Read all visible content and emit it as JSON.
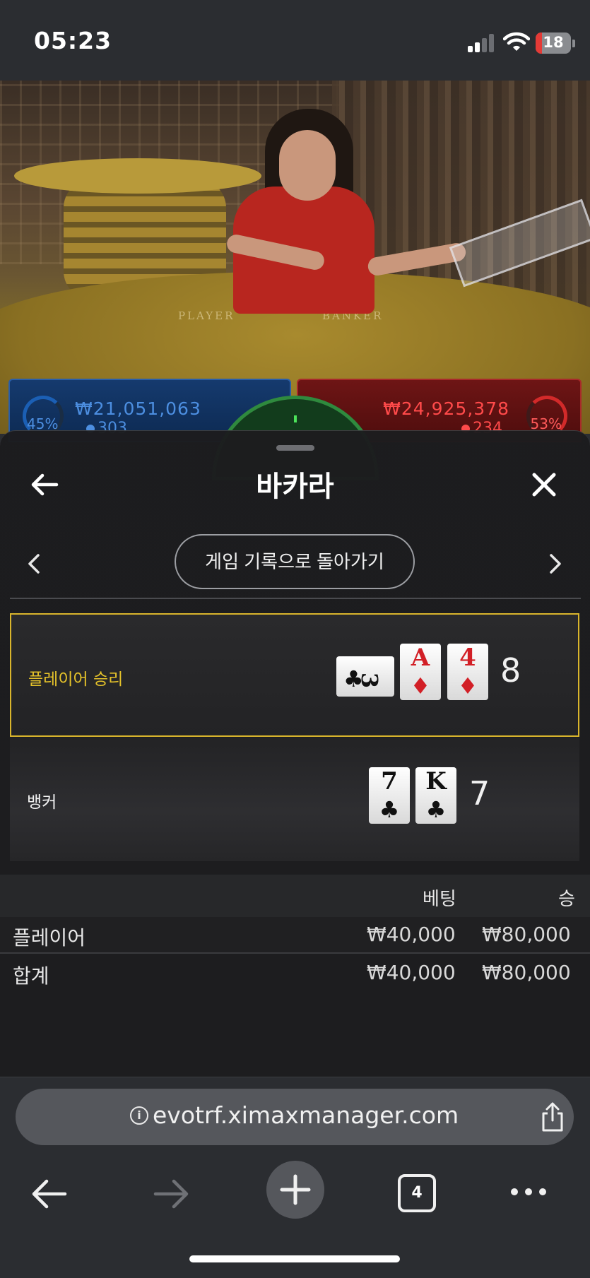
{
  "status_bar": {
    "time": "05:23",
    "battery": "18",
    "battery_color": "#e43a36"
  },
  "video": {
    "felt_player": "PLAYER",
    "felt_banker": "BANKER",
    "player_bets": {
      "percent": "45%",
      "amount": "₩21,051,063",
      "count": "303"
    },
    "banker_bets": {
      "percent": "53%",
      "amount": "₩24,925,378",
      "count": "234"
    }
  },
  "sheet": {
    "title": "바카라",
    "history_button": "게임 기록으로 돌아가기",
    "results": {
      "player": {
        "label": "플레이어 승리",
        "score": "8",
        "cards": [
          {
            "rank": "3",
            "suit": "♣",
            "color": "black",
            "sideways": true
          },
          {
            "rank": "A",
            "suit": "♦",
            "color": "red"
          },
          {
            "rank": "4",
            "suit": "♦",
            "color": "red"
          }
        ]
      },
      "banker": {
        "label": "뱅커",
        "score": "7",
        "cards": [
          {
            "rank": "7",
            "suit": "♣",
            "color": "black"
          },
          {
            "rank": "K",
            "suit": "♣",
            "color": "black"
          }
        ]
      }
    },
    "table": {
      "headers": {
        "bet": "베팅",
        "win": "승"
      },
      "rows": [
        {
          "name": "플레이어",
          "bet": "₩40,000",
          "win": "₩80,000"
        },
        {
          "name": "합계",
          "bet": "₩40,000",
          "win": "₩80,000"
        }
      ]
    }
  },
  "browser": {
    "url": "evotrf.ximaxmanager.com",
    "tab_count": "4",
    "icons": [
      "back-arrow",
      "forward-arrow",
      "new-tab-plus",
      "tabs",
      "more-dots",
      "share",
      "info"
    ]
  },
  "colors": {
    "winner_highlight": "#d9b52c",
    "player_blue": "#4c8ee0",
    "banker_red": "#ff4a4a"
  }
}
